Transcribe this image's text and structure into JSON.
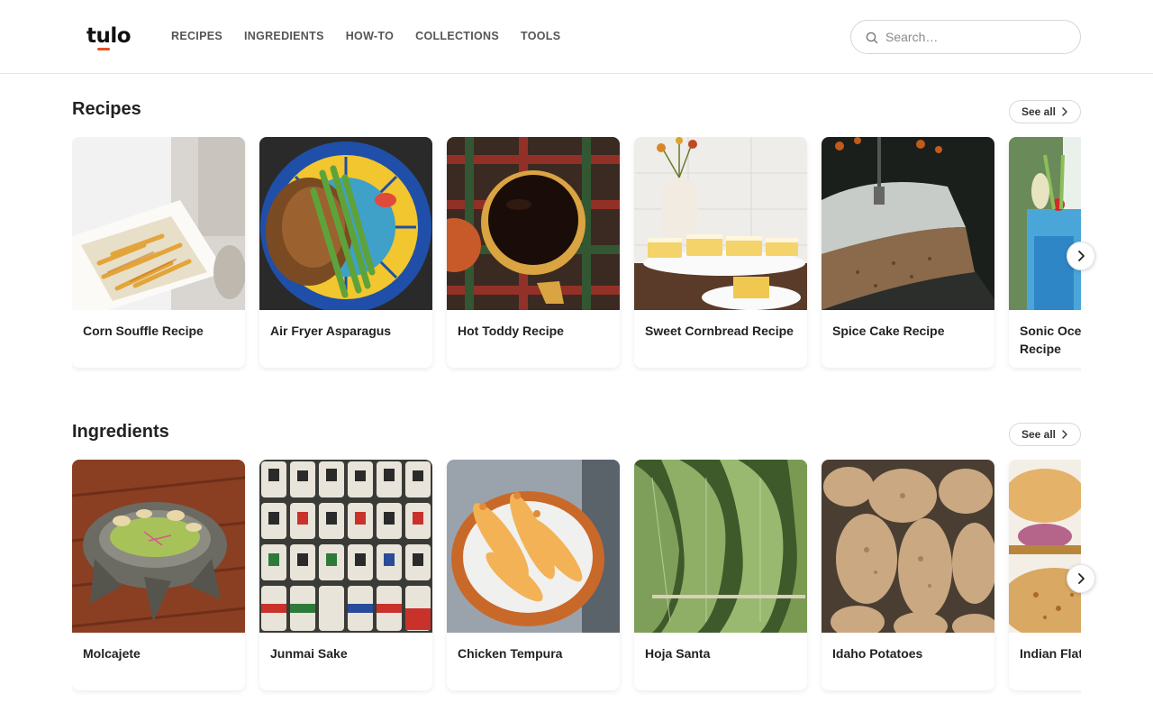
{
  "brand": {
    "logo_text": "tulo",
    "accent_color": "#e8501f"
  },
  "nav": {
    "items": [
      "RECIPES",
      "INGREDIENTS",
      "HOW-TO",
      "COLLECTIONS",
      "TOOLS"
    ]
  },
  "search": {
    "placeholder": "Search…",
    "icon": "search-icon"
  },
  "sections": [
    {
      "title": "Recipes",
      "see_all_label": "See all",
      "cards": [
        {
          "title": "Corn Souffle Recipe"
        },
        {
          "title": "Air Fryer Asparagus"
        },
        {
          "title": "Hot Toddy Recipe"
        },
        {
          "title": "Sweet Cornbread Recipe"
        },
        {
          "title": "Spice Cake Recipe"
        },
        {
          "title": "Sonic Ocean Water Recipe"
        }
      ]
    },
    {
      "title": "Ingredients",
      "see_all_label": "See all",
      "cards": [
        {
          "title": "Molcajete"
        },
        {
          "title": "Junmai Sake"
        },
        {
          "title": "Chicken Tempura"
        },
        {
          "title": "Hoja Santa"
        },
        {
          "title": "Idaho Potatoes"
        },
        {
          "title": "Indian Flatbread"
        }
      ]
    }
  ]
}
